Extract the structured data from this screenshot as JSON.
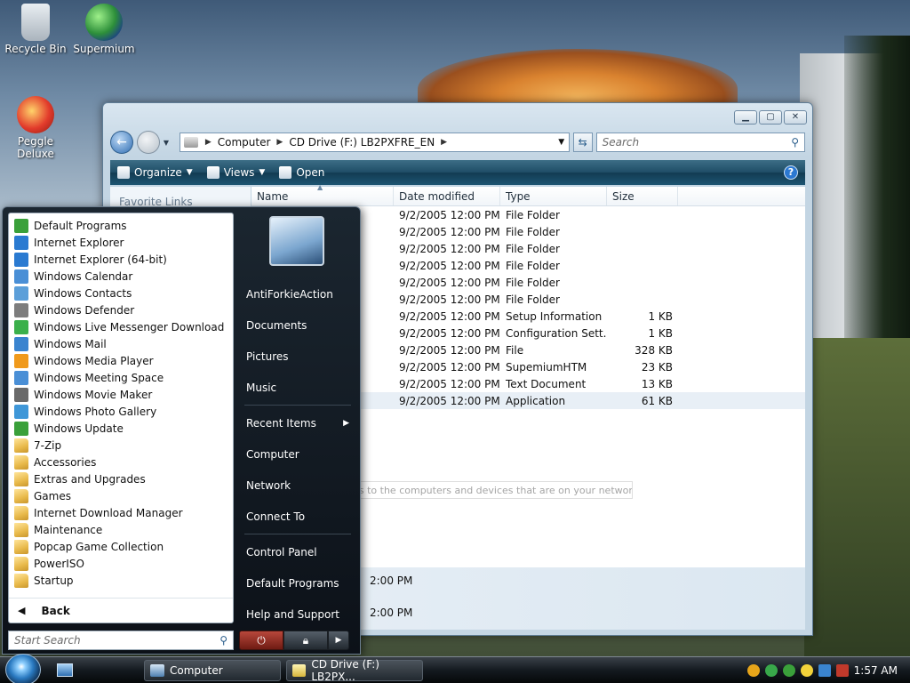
{
  "desktop": {
    "icons": [
      {
        "label": "Recycle Bin"
      },
      {
        "label": "Supermium"
      },
      {
        "label": "Peggle Deluxe"
      }
    ]
  },
  "explorer": {
    "address": {
      "crumbs": [
        "Computer",
        "CD Drive (F:) LB2PXFRE_EN"
      ]
    },
    "search_placeholder": "Search",
    "toolbar": {
      "organize": "Organize",
      "views": "Views",
      "open": "Open",
      "help": "?"
    },
    "favorite_links": "Favorite Links",
    "columns": {
      "name": "Name",
      "date": "Date modified",
      "type": "Type",
      "size": "Size"
    },
    "rows": [
      {
        "date": "9/2/2005 12:00 PM",
        "type": "File Folder",
        "size": ""
      },
      {
        "date": "9/2/2005 12:00 PM",
        "type": "File Folder",
        "size": ""
      },
      {
        "date": "9/2/2005 12:00 PM",
        "type": "File Folder",
        "size": ""
      },
      {
        "date": "9/2/2005 12:00 PM",
        "type": "File Folder",
        "size": ""
      },
      {
        "date": "9/2/2005 12:00 PM",
        "type": "File Folder",
        "size": ""
      },
      {
        "date": "9/2/2005 12:00 PM",
        "type": "File Folder",
        "size": ""
      },
      {
        "date": "9/2/2005 12:00 PM",
        "type": "Setup Information",
        "size": "1 KB"
      },
      {
        "date": "9/2/2005 12:00 PM",
        "type": "Configuration Sett...",
        "size": "1 KB"
      },
      {
        "date": "9/2/2005 12:00 PM",
        "type": "File",
        "size": "328 KB"
      },
      {
        "date": "9/2/2005 12:00 PM",
        "type": "SupemiumHTM",
        "size": "23 KB"
      },
      {
        "date": "9/2/2005 12:00 PM",
        "type": "Text Document",
        "size": "13 KB"
      },
      {
        "date": "9/2/2005 12:00 PM",
        "type": "Application",
        "size": "61 KB"
      }
    ],
    "details": {
      "line1": "2:00 PM",
      "line2": "2:00 PM"
    }
  },
  "tooltip": "Browse access to the computers and devices that are on your network.",
  "start_menu": {
    "programs": [
      {
        "label": "Default Programs",
        "icon": "default-programs-icon",
        "color": "#3aa03a"
      },
      {
        "label": "Internet Explorer",
        "icon": "internet-explorer-icon",
        "color": "#2a7ad1"
      },
      {
        "label": "Internet Explorer (64-bit)",
        "icon": "internet-explorer-icon",
        "color": "#2a7ad1"
      },
      {
        "label": "Windows Calendar",
        "icon": "calendar-icon",
        "color": "#4a8fd6"
      },
      {
        "label": "Windows Contacts",
        "icon": "contacts-icon",
        "color": "#5c9fd9"
      },
      {
        "label": "Windows Defender",
        "icon": "defender-icon",
        "color": "#7d7d7d"
      },
      {
        "label": "Windows Live Messenger Download",
        "icon": "messenger-icon",
        "color": "#3bb04b"
      },
      {
        "label": "Windows Mail",
        "icon": "mail-icon",
        "color": "#3a84cf"
      },
      {
        "label": "Windows Media Player",
        "icon": "media-player-icon",
        "color": "#f09a1c"
      },
      {
        "label": "Windows Meeting Space",
        "icon": "meeting-space-icon",
        "color": "#4a8fd6"
      },
      {
        "label": "Windows Movie Maker",
        "icon": "movie-maker-icon",
        "color": "#6a6a6a"
      },
      {
        "label": "Windows Photo Gallery",
        "icon": "photo-gallery-icon",
        "color": "#3f97d8"
      },
      {
        "label": "Windows Update",
        "icon": "update-icon",
        "color": "#3aa03a"
      },
      {
        "label": "7-Zip",
        "icon": "folder-icon",
        "color": "folder"
      },
      {
        "label": "Accessories",
        "icon": "folder-icon",
        "color": "folder"
      },
      {
        "label": "Extras and Upgrades",
        "icon": "folder-icon",
        "color": "folder"
      },
      {
        "label": "Games",
        "icon": "folder-icon",
        "color": "folder"
      },
      {
        "label": "Internet Download Manager",
        "icon": "folder-icon",
        "color": "folder"
      },
      {
        "label": "Maintenance",
        "icon": "folder-icon",
        "color": "folder"
      },
      {
        "label": "Popcap Game Collection",
        "icon": "folder-icon",
        "color": "folder"
      },
      {
        "label": "PowerISO",
        "icon": "folder-icon",
        "color": "folder"
      },
      {
        "label": "Startup",
        "icon": "folder-icon",
        "color": "folder"
      }
    ],
    "back": "Back",
    "search_placeholder": "Start Search",
    "right_items": [
      {
        "label": "AntiForkieAction",
        "arrow": false,
        "sep_after": false
      },
      {
        "label": "Documents",
        "arrow": false,
        "sep_after": false
      },
      {
        "label": "Pictures",
        "arrow": false,
        "sep_after": false
      },
      {
        "label": "Music",
        "arrow": false,
        "sep_after": true
      },
      {
        "label": "Recent Items",
        "arrow": true,
        "sep_after": false
      },
      {
        "label": "Computer",
        "arrow": false,
        "sep_after": false
      },
      {
        "label": "Network",
        "arrow": false,
        "sep_after": false
      },
      {
        "label": "Connect To",
        "arrow": false,
        "sep_after": true
      },
      {
        "label": "Control Panel",
        "arrow": false,
        "sep_after": false
      },
      {
        "label": "Default Programs",
        "arrow": false,
        "sep_after": false
      },
      {
        "label": "Help and Support",
        "arrow": false,
        "sep_after": false
      }
    ]
  },
  "taskbar": {
    "buttons": [
      {
        "label": "Computer"
      },
      {
        "label": "CD Drive (F:) LB2PX..."
      }
    ],
    "clock": "1:57 AM"
  }
}
